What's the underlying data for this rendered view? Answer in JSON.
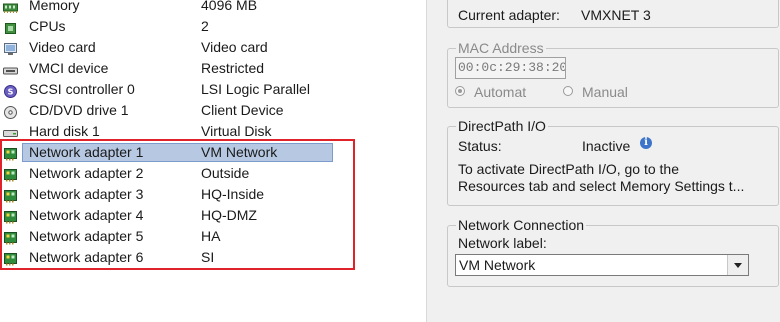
{
  "hardware": [
    {
      "name": "Memory",
      "summary": "4096 MB",
      "icon": "memory-icon"
    },
    {
      "name": "CPUs",
      "summary": "2",
      "icon": "cpu-icon"
    },
    {
      "name": "Video card",
      "summary": "Video card",
      "icon": "monitor-icon"
    },
    {
      "name": "VMCI device",
      "summary": "Restricted",
      "icon": "vmci-icon"
    },
    {
      "name": "SCSI controller 0",
      "summary": "LSI Logic Parallel",
      "icon": "scsi-icon"
    },
    {
      "name": "CD/DVD drive 1",
      "summary": "Client Device",
      "icon": "cd-drive-icon"
    },
    {
      "name": "Hard disk 1",
      "summary": "Virtual Disk",
      "icon": "hard-disk-icon"
    },
    {
      "name": "Network adapter 1",
      "summary": "VM Network",
      "icon": "network-adapter-icon"
    },
    {
      "name": "Network adapter 2",
      "summary": "Outside",
      "icon": "network-adapter-icon"
    },
    {
      "name": "Network adapter 3",
      "summary": "HQ-Inside",
      "icon": "network-adapter-icon"
    },
    {
      "name": "Network adapter 4",
      "summary": "HQ-DMZ",
      "icon": "network-adapter-icon"
    },
    {
      "name": "Network adapter 5",
      "summary": "HA",
      "icon": "network-adapter-icon"
    },
    {
      "name": "Network adapter 6",
      "summary": "SI",
      "icon": "network-adapter-icon"
    }
  ],
  "selected_index": 7,
  "highlight_color": "#e0232b",
  "adapter": {
    "current_label": "Current adapter:",
    "current_value": "VMXNET 3"
  },
  "mac": {
    "legend": "MAC Address",
    "value": "00:0c:29:38:20:",
    "automatic": "Automat",
    "manual": "Manual"
  },
  "directpath": {
    "legend": "DirectPath I/O",
    "status_label": "Status:",
    "status_value": "Inactive",
    "info_glyph": "i",
    "hint_line1": "To activate DirectPath I/O, go to the",
    "hint_line2": "Resources tab and select Memory Settings t..."
  },
  "connection": {
    "legend": "Network Connection",
    "label": "Network label:",
    "value": "VM Network"
  }
}
